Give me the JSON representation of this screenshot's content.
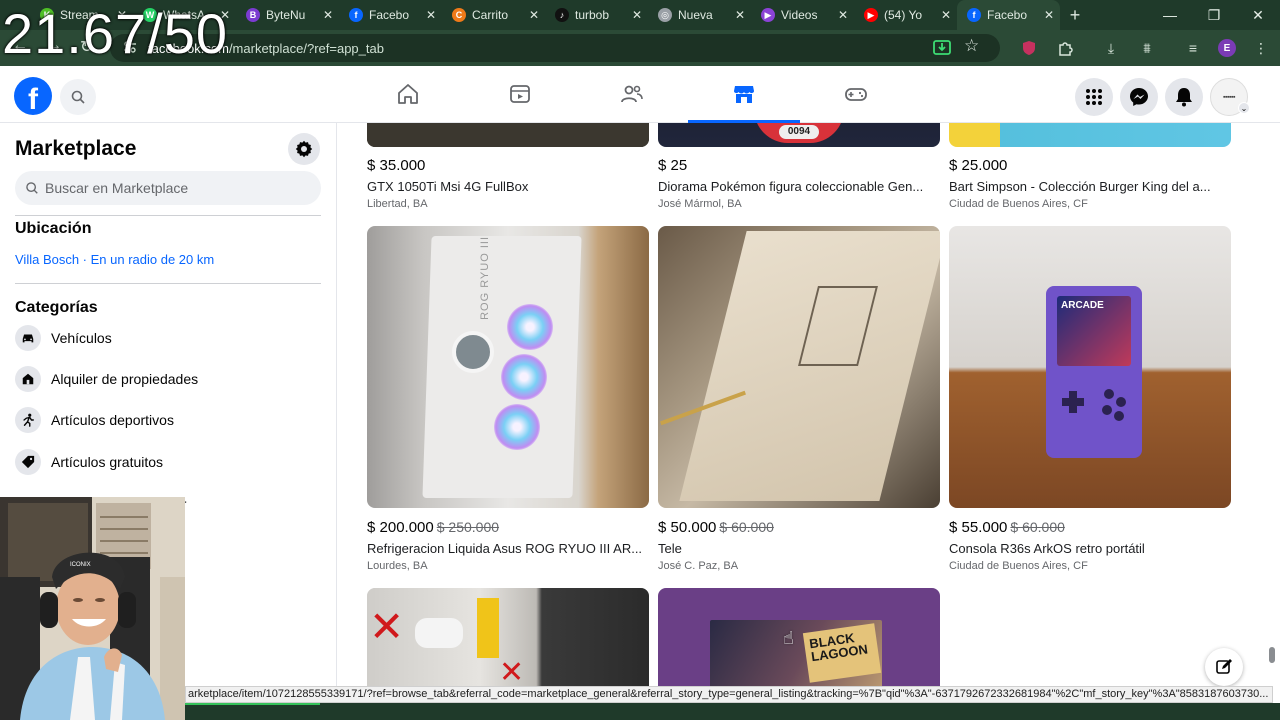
{
  "overlay": {
    "timer_text": "21.67/50"
  },
  "browser": {
    "tabs": [
      {
        "title": "Stream",
        "icon": "stream-icon",
        "color": "#4fbf26",
        "glyph": "K"
      },
      {
        "title": "WhatsA",
        "icon": "whatsapp-icon",
        "color": "#25d366",
        "glyph": "W"
      },
      {
        "title": "ByteNu",
        "icon": "bytenu-icon",
        "color": "#7b3bd1",
        "glyph": "B"
      },
      {
        "title": "Facebo",
        "icon": "facebook-icon",
        "color": "#0866ff",
        "glyph": "f"
      },
      {
        "title": "Carrito",
        "icon": "cart-icon",
        "color": "#ef7a19",
        "glyph": "C"
      },
      {
        "title": "turbob",
        "icon": "tiktok-icon",
        "color": "#111111",
        "glyph": "♪"
      },
      {
        "title": "Nueva",
        "icon": "chrome-icon",
        "color": "#9aa0a6",
        "glyph": "◎"
      },
      {
        "title": "Videos",
        "icon": "video-icon",
        "color": "#8b43d6",
        "glyph": "▶"
      },
      {
        "title": "(54) Yo",
        "icon": "youtube-icon",
        "color": "#ff0000",
        "glyph": "▶"
      },
      {
        "title": "Facebo",
        "icon": "facebook-icon",
        "color": "#0866ff",
        "glyph": "f",
        "active": true
      }
    ],
    "url_host": "facebook.com",
    "url_path": "/marketplace/?ref=app_tab",
    "profile_letter": "E"
  },
  "sidebar": {
    "title": "Marketplace",
    "search_placeholder": "Buscar en Marketplace",
    "location_heading": "Ubicación",
    "location_value": "Villa Bosch · En un radio de 20 km",
    "categories_heading": "Categorías",
    "categories": [
      {
        "label": "Vehículos",
        "icon": "car-icon"
      },
      {
        "label": "Alquiler de propiedades",
        "icon": "house-icon"
      },
      {
        "label": "Artículos deportivos",
        "icon": "running-icon"
      },
      {
        "label": "Artículos gratuitos",
        "icon": "tag-icon"
      }
    ],
    "partial_item": "ar"
  },
  "listings": {
    "row1": [
      {
        "price": "$ 35.000",
        "old_price": "",
        "title": "GTX 1050Ti Msi 4G FullBox",
        "location": "Libertad, BA"
      },
      {
        "price": "$ 25",
        "old_price": "",
        "title": "Diorama Pokémon figura coleccionable Gen...",
        "location": "José Mármol, BA"
      },
      {
        "price": "$ 25.000",
        "old_price": "",
        "title": "Bart Simpson - Colección Burger King del a...",
        "location": "Ciudad de Buenos Aires, CF"
      }
    ],
    "row2": [
      {
        "price": "$ 200.000",
        "old_price": "$ 250.000",
        "title": "Refrigeracion Liquida Asus ROG RYUO III AR...",
        "location": "Lourdes, BA"
      },
      {
        "price": "$ 50.000",
        "old_price": "$ 60.000",
        "title": "Tele",
        "location": "José C. Paz, BA"
      },
      {
        "price": "$ 55.000",
        "old_price": "$ 60.000",
        "title": "Consola R36s ArkOS retro portátil",
        "location": "Ciudad de Buenos Aires, CF"
      }
    ],
    "img_text": {
      "pokemon_number": "0094",
      "cooler_brand": "ROG RYUO III",
      "console_screen": "ARCADE",
      "manga_title": "BLACK LAGOON"
    }
  },
  "statusbar": {
    "text": "arketplace/item/1072128555339171/?ref=browse_tab&referral_code=marketplace_general&referral_story_type=general_listing&tracking=%7B\"qid\"%3A\"-6371792672332681984\"%2C\"mf_story_key\"%3A\"8583187603730..."
  },
  "page_progress": 0.25
}
